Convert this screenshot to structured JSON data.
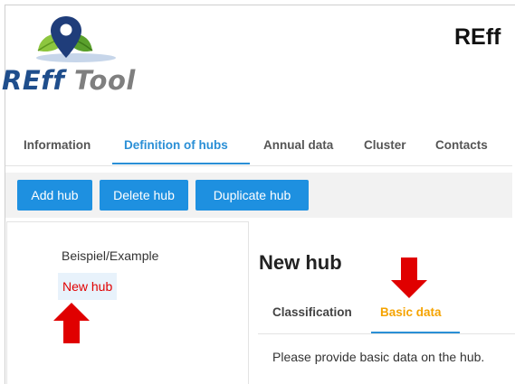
{
  "logo": {
    "text_reff": "REff",
    "text_tool": "Tool"
  },
  "header": {
    "title": "REff"
  },
  "nav": {
    "tabs": [
      "Information",
      "Definition of hubs",
      "Annual data",
      "Cluster",
      "Contacts"
    ],
    "active_index": 1
  },
  "toolbar": {
    "add_label": "Add hub",
    "delete_label": "Delete hub",
    "duplicate_label": "Duplicate hub"
  },
  "hubs": {
    "items": [
      "Beispiel/Example",
      "New hub"
    ],
    "selected_index": 1
  },
  "detail": {
    "title": "New hub",
    "tabs": [
      "Classification",
      "Basic data"
    ],
    "active_tab": 1,
    "hint": "Please provide basic data on the hub."
  },
  "colors": {
    "accent_blue": "#1e90e0",
    "selected_red": "#e10000",
    "active_subtab_orange": "#f5a300",
    "annotation_arrow": "#e00000"
  },
  "icons": [
    "location-pin-leaf-icon",
    "annotation-arrow-up-icon",
    "annotation-arrow-down-icon"
  ]
}
